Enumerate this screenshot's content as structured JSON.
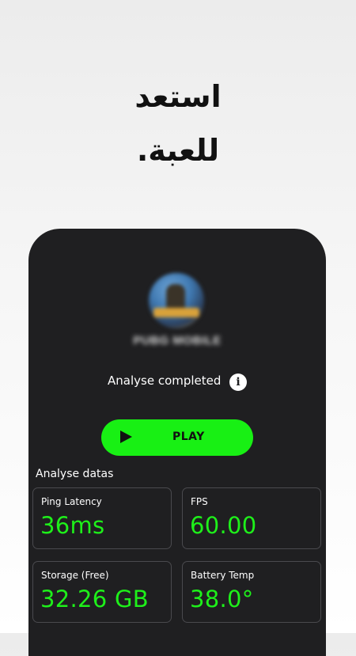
{
  "headline": {
    "line1": "استعد",
    "line2": "للعبة."
  },
  "game": {
    "name": "PUBG MOBILE",
    "icon": "pubg-game-icon"
  },
  "status": {
    "text": "Analyse completed",
    "info_icon": "info-icon",
    "info_glyph": "i"
  },
  "play_button": {
    "label": "PLAY",
    "icon": "play-icon",
    "color": "#18f014"
  },
  "analysis": {
    "title": "Analyse datas",
    "metrics": [
      {
        "label": "Ping Latency",
        "value": "36ms"
      },
      {
        "label": "FPS",
        "value": "60.00"
      },
      {
        "label": "Storage (Free)",
        "value": "32.26 GB"
      },
      {
        "label": "Battery Temp",
        "value": "38.0°"
      }
    ]
  },
  "colors": {
    "accent": "#1ef01a",
    "panel": "#1f1f21",
    "card_border": "#4a4a4e"
  }
}
